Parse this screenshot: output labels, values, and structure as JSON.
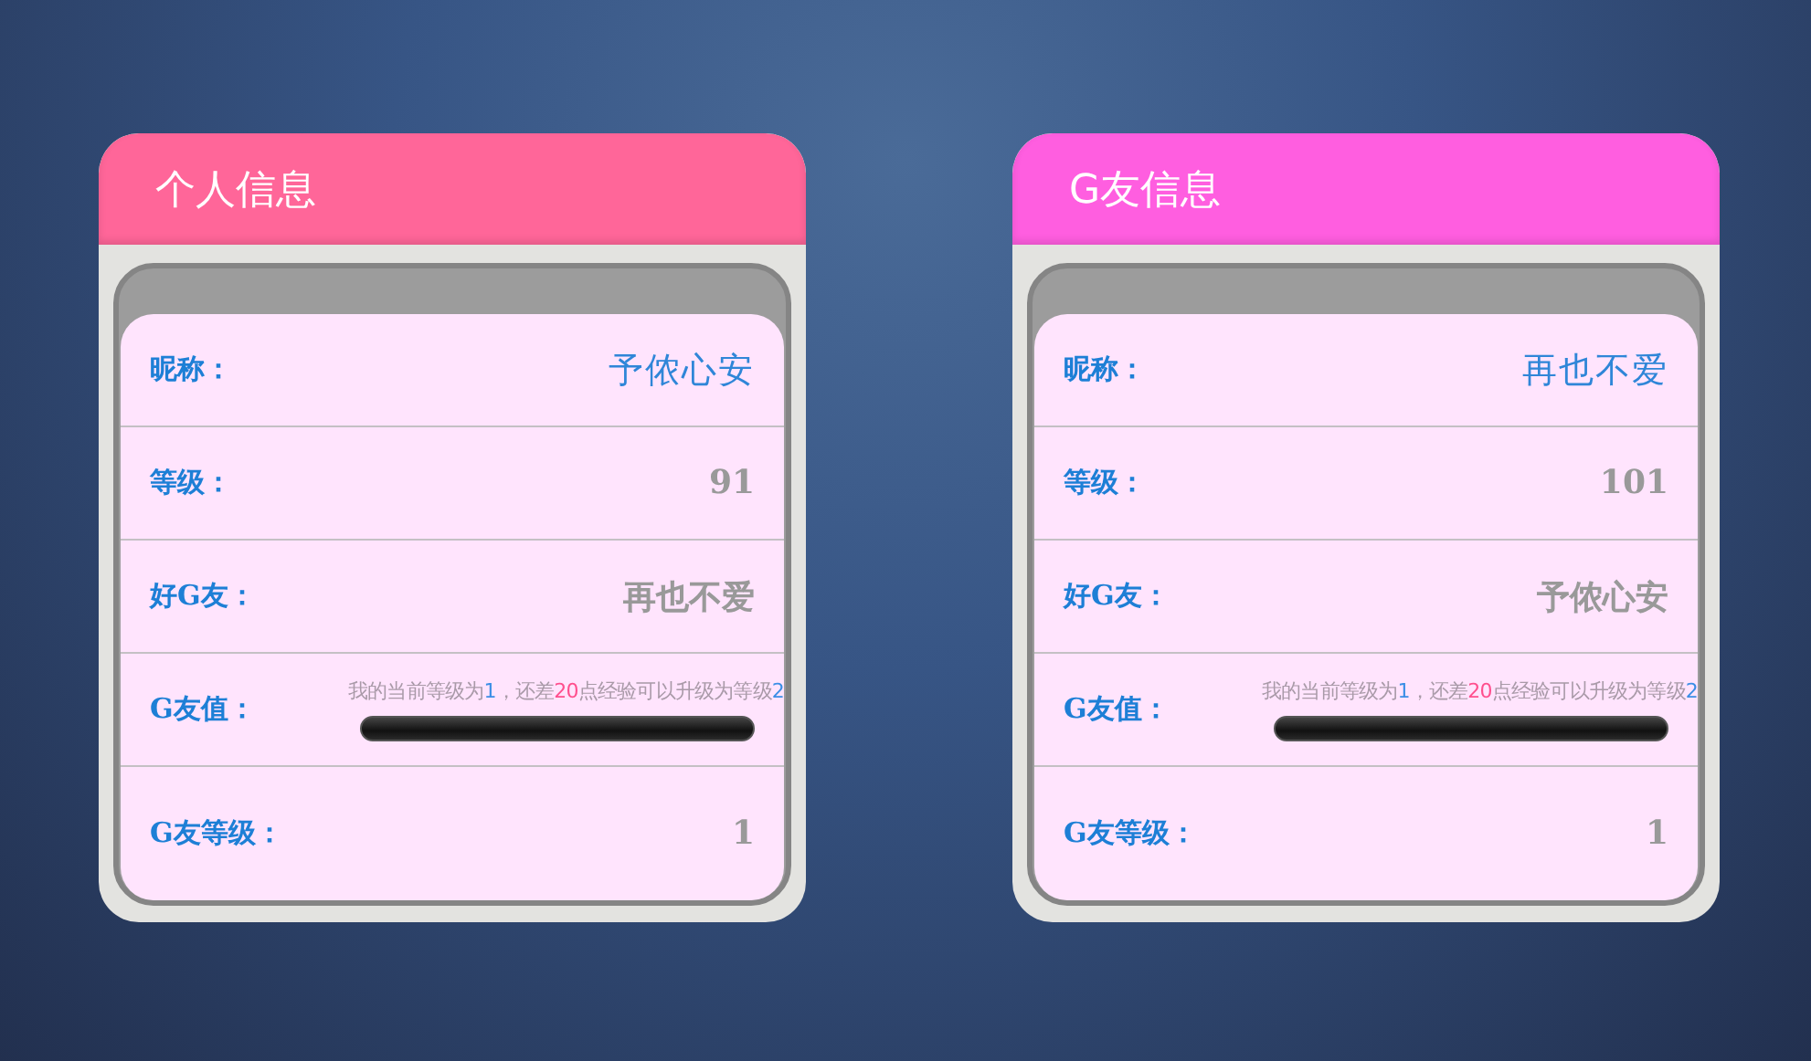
{
  "cards": [
    {
      "title": "个人信息",
      "color": "#ff6699",
      "rows": [
        {
          "kind": "name",
          "label": "昵称：",
          "value": "予侬心安"
        },
        {
          "kind": "plain",
          "label": "等级：",
          "value": "91"
        },
        {
          "kind": "plain",
          "label": "好G友：",
          "value": "再也不爱"
        },
        {
          "kind": "progress",
          "label": "G友值：",
          "text": [
            {
              "kind": "plain",
              "text": "我的当前等级为"
            },
            {
              "kind": "level",
              "text": "1"
            },
            {
              "kind": "plain",
              "text": "，还差"
            },
            {
              "kind": "points",
              "text": "20"
            },
            {
              "kind": "plain",
              "text": "点经验可以升级为等级"
            },
            {
              "kind": "level",
              "text": "2"
            }
          ]
        },
        {
          "kind": "plain",
          "label": "G友等级：",
          "value": "1"
        }
      ]
    },
    {
      "title": "G友信息",
      "color": "#ff5ee0",
      "rows": [
        {
          "kind": "name",
          "label": "昵称：",
          "value": "再也不爱"
        },
        {
          "kind": "plain",
          "label": "等级：",
          "value": "101"
        },
        {
          "kind": "plain",
          "label": "好G友：",
          "value": "予侬心安"
        },
        {
          "kind": "progress",
          "label": "G友值：",
          "text": [
            {
              "kind": "plain",
              "text": "我的当前等级为"
            },
            {
              "kind": "level",
              "text": "1"
            },
            {
              "kind": "plain",
              "text": "，还差"
            },
            {
              "kind": "points",
              "text": "20"
            },
            {
              "kind": "plain",
              "text": "点经验可以升级为等级"
            },
            {
              "kind": "level",
              "text": "2"
            }
          ]
        },
        {
          "kind": "plain",
          "label": "G友等级：",
          "value": "1"
        }
      ]
    }
  ]
}
